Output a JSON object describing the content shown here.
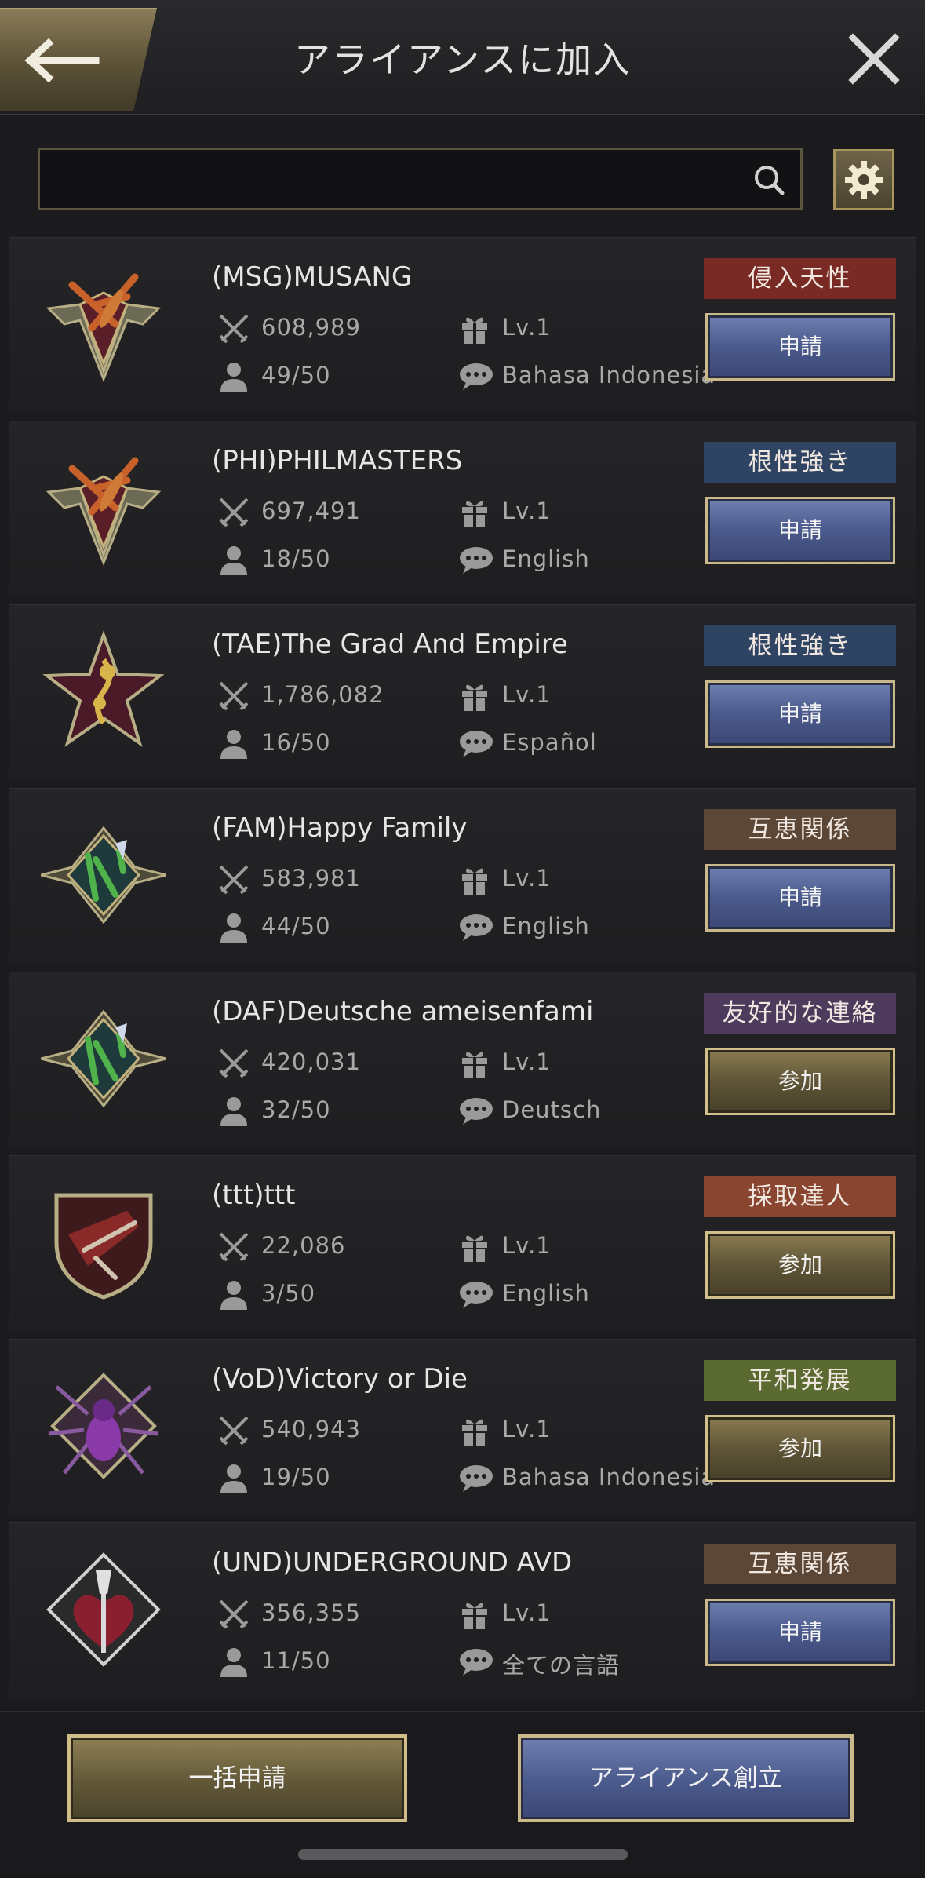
{
  "header": {
    "title": "アライアンスに加入"
  },
  "search": {
    "value": "",
    "placeholder": ""
  },
  "colors": {
    "apply_button": "#4b5a8c",
    "join_button": "#5f5536",
    "gold_border": "#c9b88a"
  },
  "alliances": [
    {
      "name": "(MSG)MUSANG",
      "power": "608,989",
      "level": "Lv.1",
      "members": "49/50",
      "language": "Bahasa Indonesia",
      "tag": "侵入天性",
      "tag_color": "#7a2a25",
      "action": "申請",
      "action_type": "apply",
      "emblem": "dragonfly-emblem"
    },
    {
      "name": "(PHI)PHILMASTERS",
      "power": "697,491",
      "level": "Lv.1",
      "members": "18/50",
      "language": "English",
      "tag": "根性強き",
      "tag_color": "#2f4462",
      "action": "申請",
      "action_type": "apply",
      "emblem": "dragonfly-emblem"
    },
    {
      "name": "(TAE)The Grad And Empire",
      "power": "1,786,082",
      "level": "Lv.1",
      "members": "16/50",
      "language": "Español",
      "tag": "根性強き",
      "tag_color": "#2f4462",
      "action": "申請",
      "action_type": "apply",
      "emblem": "star-emblem"
    },
    {
      "name": "(FAM)Happy Family",
      "power": "583,981",
      "level": "Lv.1",
      "members": "44/50",
      "language": "English",
      "tag": "互恵関係",
      "tag_color": "#5c4636",
      "action": "申請",
      "action_type": "apply",
      "emblem": "mantis-emblem"
    },
    {
      "name": "(DAF)Deutsche ameisenfami",
      "power": "420,031",
      "level": "Lv.1",
      "members": "32/50",
      "language": "Deutsch",
      "tag": "友好的な連絡",
      "tag_color": "#4e3a5c",
      "action": "参加",
      "action_type": "join",
      "emblem": "mantis-emblem"
    },
    {
      "name": "(ttt)ttt",
      "power": "22,086",
      "level": "Lv.1",
      "members": "3/50",
      "language": "English",
      "tag": "採取達人",
      "tag_color": "#8a4530",
      "action": "参加",
      "action_type": "join",
      "emblem": "shield-beetle-emblem"
    },
    {
      "name": "(VoD)Victory or Die",
      "power": "540,943",
      "level": "Lv.1",
      "members": "19/50",
      "language": "Bahasa Indonesia",
      "tag": "平和発展",
      "tag_color": "#5a6a30",
      "action": "参加",
      "action_type": "join",
      "emblem": "spider-emblem"
    },
    {
      "name": "(UND)UNDERGROUND AVD",
      "power": "356,355",
      "level": "Lv.1",
      "members": "11/50",
      "language": "全ての言語",
      "tag": "互恵関係",
      "tag_color": "#5c4636",
      "action": "申請",
      "action_type": "apply",
      "emblem": "heart-emblem"
    }
  ],
  "footer": {
    "bulk_apply": "一括申請",
    "create_alliance": "アライアンス創立"
  }
}
